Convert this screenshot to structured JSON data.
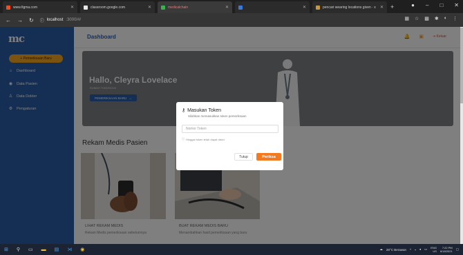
{
  "browser": {
    "tabs": [
      {
        "title": "www.figma.com",
        "favicon_color": "#f24e1e"
      },
      {
        "title": "classroom.google.com",
        "favicon_color": "#e8e8e8"
      },
      {
        "title": "medicalchain",
        "favicon_color": "#37b24d"
      },
      {
        "title": "",
        "favicon_color": "#3c78d8"
      },
      {
        "title": "pencari wearing locations given · x",
        "favicon_color": "#c49a3a"
      }
    ],
    "address": {
      "host": "localhost",
      "path": ":3000/#/"
    },
    "new_tab": "+"
  },
  "app": {
    "logo": "mc",
    "sidebar": {
      "new_exam_label": "+ Pemeriksaan Baru",
      "items": [
        {
          "label": "Dashboard",
          "icon": "home-icon"
        },
        {
          "label": "Data Pasien",
          "icon": "user-icon"
        },
        {
          "label": "Data Dokter",
          "icon": "doctor-icon"
        },
        {
          "label": "Pengaturan",
          "icon": "gear-icon"
        }
      ]
    },
    "topbar": {
      "title": "Dashboard",
      "logout_label": "Keluar"
    },
    "hero": {
      "greeting": "Hallo, Cleyra Lovelace",
      "role": "RUMAH TOBOSOLN",
      "button_label": "PEMERIKSAAN BARU"
    },
    "section_title": "Rekam Medis Pasien",
    "cards": [
      {
        "title": "LIHAT REKAM MEDIS",
        "desc": "Rekam Medis pemeriksaan sebelumnya"
      },
      {
        "title": "BUAT REKAM MEDIS BARU",
        "desc": "Menambahkan hasil pemeriksaan yang baru"
      }
    ]
  },
  "modal": {
    "title": "Masukan Token",
    "subtitle": "Silahkan memasukkan token pemeriksaan",
    "placeholder": "Nomor Token",
    "hint": "Hinggai token telah dapat disini",
    "close_label": "Tutup",
    "check_label": "Periksa"
  },
  "taskbar": {
    "weather": "28°C Berawan",
    "lang": "ENG",
    "region": "US",
    "time": "7:22 PM",
    "date": "6/18/2021"
  },
  "colors": {
    "sidebar": "#2a5ea8",
    "accent": "#f47a1f",
    "new_button": "#f5a623"
  }
}
